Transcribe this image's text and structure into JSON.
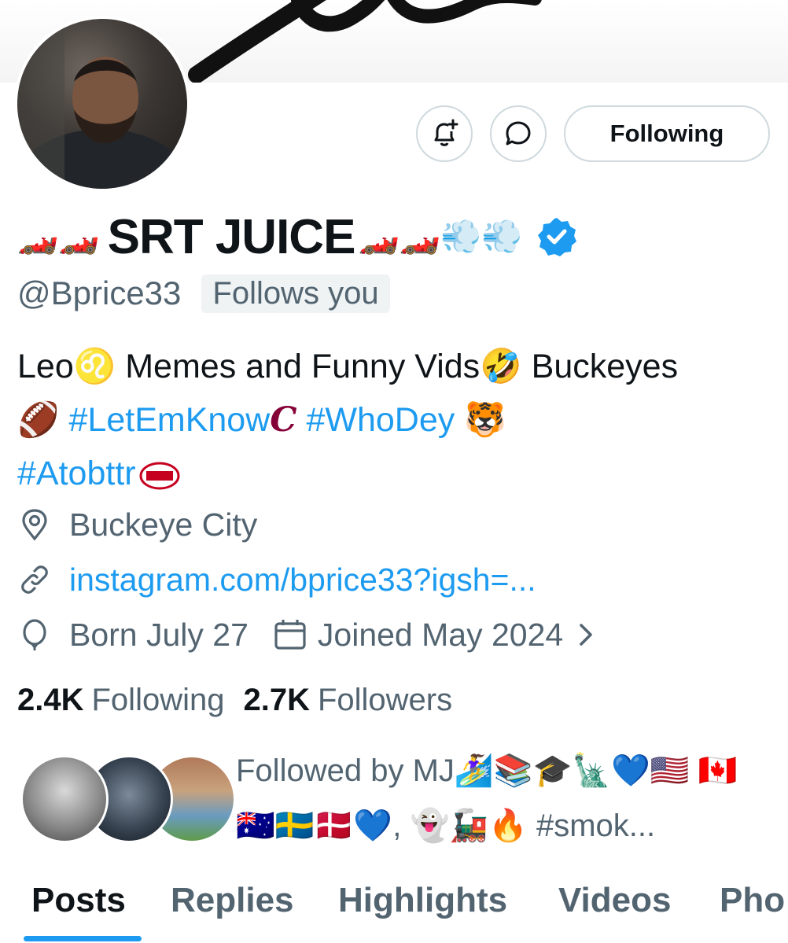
{
  "profile": {
    "name_prefix_emoji": "🏎️🏎️",
    "name": "SRT JUICE",
    "name_suffix_emoji": "🏎️🏎️💨💨",
    "handle": "@Bprice33",
    "follows_you": "Follows you",
    "verified_icon": "verified-badge-icon"
  },
  "actions": {
    "notify_icon": "bell-plus-icon",
    "message_icon": "chat-bubble-icon",
    "following_label": "Following"
  },
  "bio": {
    "line1_a": "Leo♌️ Memes and Funny Vids🤣 Buckeyes",
    "line2_a": "🏈 ",
    "tag1": "#LetEmKnow",
    "line2_b": " ",
    "tag2": "#WhoDey",
    "line2_c": " 🐯",
    "tag3": "#Atobttr"
  },
  "meta": {
    "location": "Buckeye City",
    "url": "instagram.com/bprice33?igsh=...",
    "born": "Born July 27",
    "joined": "Joined May 2024"
  },
  "counts": {
    "following_value": "2.4K",
    "following_label": "Following",
    "followers_value": "2.7K",
    "followers_label": "Followers"
  },
  "followed_by": {
    "prefix": "Followed by",
    "text": "MJ🏄‍♀️📚🎓🗽💙🇺🇸 🇨🇦🇦🇺🇸🇪🇩🇰💙, 👻🚂🔥 #smok..."
  },
  "tabs": [
    "Posts",
    "Replies",
    "Highlights",
    "Videos",
    "Pho"
  ],
  "colors": {
    "accent": "#1d9bf0",
    "text": "#0f1419",
    "secondary": "#536471",
    "border": "#cfd9de"
  }
}
